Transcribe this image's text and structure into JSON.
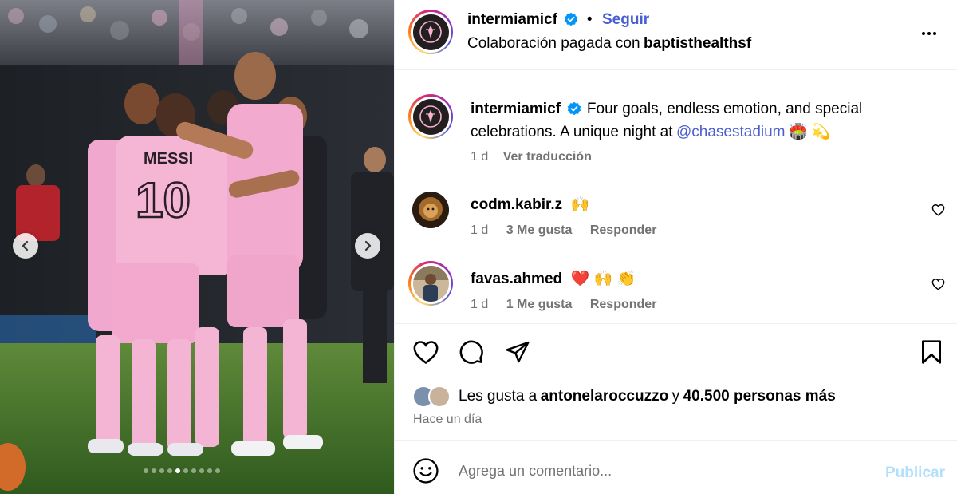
{
  "post": {
    "author": "intermiamicf",
    "follow_label": "Seguir",
    "separator": "•",
    "collab_prefix": "Colaboración pagada con",
    "collab_partner": "baptisthealthsf",
    "more_icon": "more-horizontal-icon",
    "caption_text": "Four goals, endless emotion, and special",
    "caption_line2_prefix": "celebrations. A unique night at",
    "caption_mention": "@chasestadium",
    "caption_emojis": "🏟️ 💫",
    "caption_age": "1 d",
    "translate_label": "Ver traducción"
  },
  "media": {
    "jersey_name": "MESSI",
    "jersey_number": "10",
    "slide_count": 10,
    "active_slide": 5,
    "prev_icon": "chevron-left-icon",
    "next_icon": "chevron-right-icon"
  },
  "comments": [
    {
      "user": "codm.kabir.z",
      "text": "🙌",
      "age": "1 d",
      "likes": "3 Me gusta",
      "reply": "Responder"
    },
    {
      "user": "favas.ahmed",
      "text": "❤️ 🙌 👏",
      "age": "1 d",
      "likes": "1 Me gusta",
      "reply": "Responder"
    }
  ],
  "likes": {
    "prefix": "Les gusta a",
    "user": "antonelaroccuzzo",
    "connector": "y",
    "count_text": "40.500 personas más",
    "timestamp": "Hace un día"
  },
  "composer": {
    "placeholder": "Agrega un comentario...",
    "publish_label": "Publicar"
  },
  "colors": {
    "accent_blue": "#4a5ed4",
    "publish_disabled": "#b2dffc",
    "verified_blue": "#0095f6",
    "jersey_pink": "#f5b6d6"
  }
}
